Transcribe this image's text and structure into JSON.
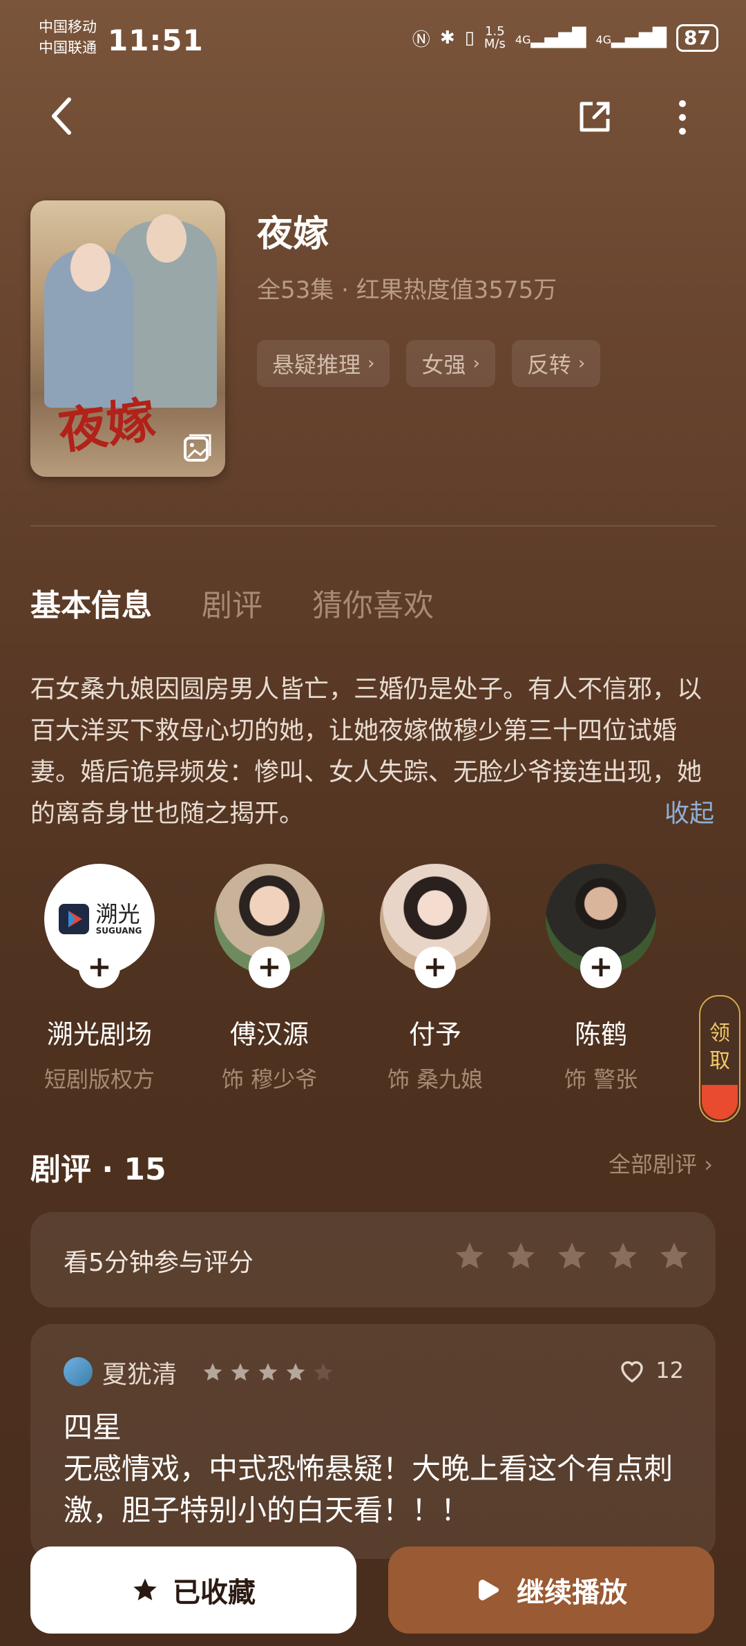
{
  "status_bar": {
    "carrier1": "中国移动",
    "carrier2": "中国联通",
    "time": "11:51",
    "speed": "1.5",
    "speed_unit": "M/s",
    "net1": "4G",
    "net2": "4G",
    "battery": "87"
  },
  "drama": {
    "title": "夜嫁",
    "poster_title": "夜嫁",
    "meta": "全53集 · 红果热度值3575万",
    "tags": [
      {
        "label": "悬疑推理"
      },
      {
        "label": "女强"
      },
      {
        "label": "反转"
      }
    ]
  },
  "tabs": [
    {
      "label": "基本信息"
    },
    {
      "label": "剧评"
    },
    {
      "label": "猜你喜欢"
    }
  ],
  "synopsis": "石女桑九娘因圆房男人皆亡，三婚仍是处子。有人不信邪，以百大洋买下救母心切的她，让她夜嫁做穆少第三十四位试婚妻。婚后诡异频发：惨叫、女人失踪、无脸少爷接连出现，她的离奇身世也随之揭开。",
  "collapse_label": "收起",
  "cast": [
    {
      "name": "溯光剧场",
      "role": "短剧版权方",
      "logo_cn": "溯光",
      "logo_en": "SUGUANG"
    },
    {
      "name": "傅汉源",
      "role": "饰 穆少爷"
    },
    {
      "name": "付予",
      "role": "饰 桑九娘"
    },
    {
      "name": "陈鹤",
      "role": "饰 警张"
    }
  ],
  "claim": {
    "line1": "领",
    "line2": "取"
  },
  "reviews_section": {
    "title": "剧评 · 15",
    "all_label": "全部剧评 ›",
    "rate_prompt": "看5分钟参与评分"
  },
  "review": {
    "user": "夏犹清",
    "stars": 4,
    "likes": "12",
    "line1": "四星",
    "line2": "无感情戏，中式恐怖悬疑！大晚上看这个有点刺激，胆子特别小的白天看！！！"
  },
  "actions": {
    "favorite": "已收藏",
    "play": "继续播放"
  },
  "colors": {
    "accent": "#9a5a33",
    "link": "#8fb0d8"
  }
}
